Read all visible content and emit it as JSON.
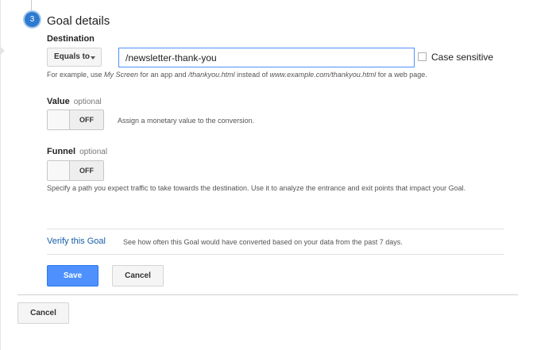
{
  "step": {
    "number": "3",
    "title": "Goal details"
  },
  "destination": {
    "label": "Destination",
    "match_type": "Equals to",
    "value": "/newsletter-thank-you",
    "case_sensitive_label": "Case sensitive",
    "case_sensitive_checked": false,
    "hint_parts": {
      "p1": "For example, use ",
      "p2": "My Screen",
      "p3": " for an app and ",
      "p4": "/thankyou.html",
      "p5": " instead of ",
      "p6": "www.example.com/thankyou.html",
      "p7": " for a web page."
    }
  },
  "value_section": {
    "label": "Value",
    "optional": "optional",
    "toggle_state": "OFF",
    "description": "Assign a monetary value to the conversion."
  },
  "funnel_section": {
    "label": "Funnel",
    "optional": "optional",
    "toggle_state": "OFF",
    "description": "Specify a path you expect traffic to take towards the destination. Use it to analyze the entrance and exit points that impact your Goal."
  },
  "verify": {
    "link": "Verify this Goal",
    "description": "See how often this Goal would have converted based on your data from the past 7 days."
  },
  "actions": {
    "save": "Save",
    "cancel": "Cancel",
    "outer_cancel": "Cancel"
  },
  "colors": {
    "accent": "#4d90fe",
    "link": "#1a5ea8",
    "step_badge": "#2d7bd0"
  }
}
